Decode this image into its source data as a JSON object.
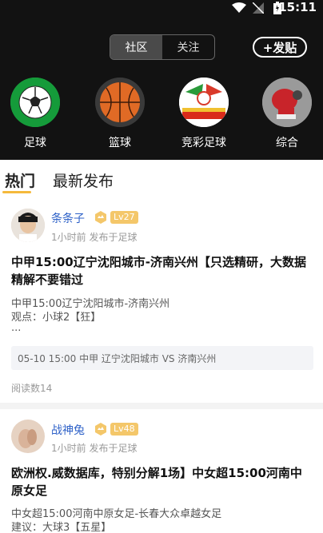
{
  "status": {
    "time": "15:11"
  },
  "header": {
    "segments": [
      "社区",
      "关注"
    ],
    "post_button": "+发贴",
    "categories": [
      {
        "label": "足球",
        "icon": "soccer-ball-icon"
      },
      {
        "label": "篮球",
        "icon": "basketball-icon"
      },
      {
        "label": "竞彩足球",
        "icon": "lottery-soccer-icon"
      },
      {
        "label": "综合",
        "icon": "boxing-glove-icon"
      }
    ]
  },
  "tabs": [
    "热门",
    "最新发布"
  ],
  "posts": [
    {
      "username": "条条子",
      "level": "Lv27",
      "meta": "1小时前 发布于足球",
      "title": "中甲15:00辽宁沈阳城市-济南兴州【只选精研，大数据精解不要错过",
      "body": [
        "中甲15:00辽宁沈阳城市-济南兴州",
        "观点：小球2【狂】",
        "..."
      ],
      "match": "05-10 15:00 中甲 辽宁沈阳城市 VS 济南兴州",
      "reads": "阅读数14"
    },
    {
      "username": "战神兔",
      "level": "Lv48",
      "meta": "1小时前 发布于足球",
      "title": "欧洲权.威数据库，特别分解1场】中女超15:00河南中原女足",
      "body": [
        "中女超15:00河南中原女足-长春大众卓越女足",
        "建议：大球3【五星】"
      ]
    }
  ],
  "colors": {
    "accent": "#f5b93c",
    "username": "#2f62c8",
    "header_bg": "#121212"
  }
}
